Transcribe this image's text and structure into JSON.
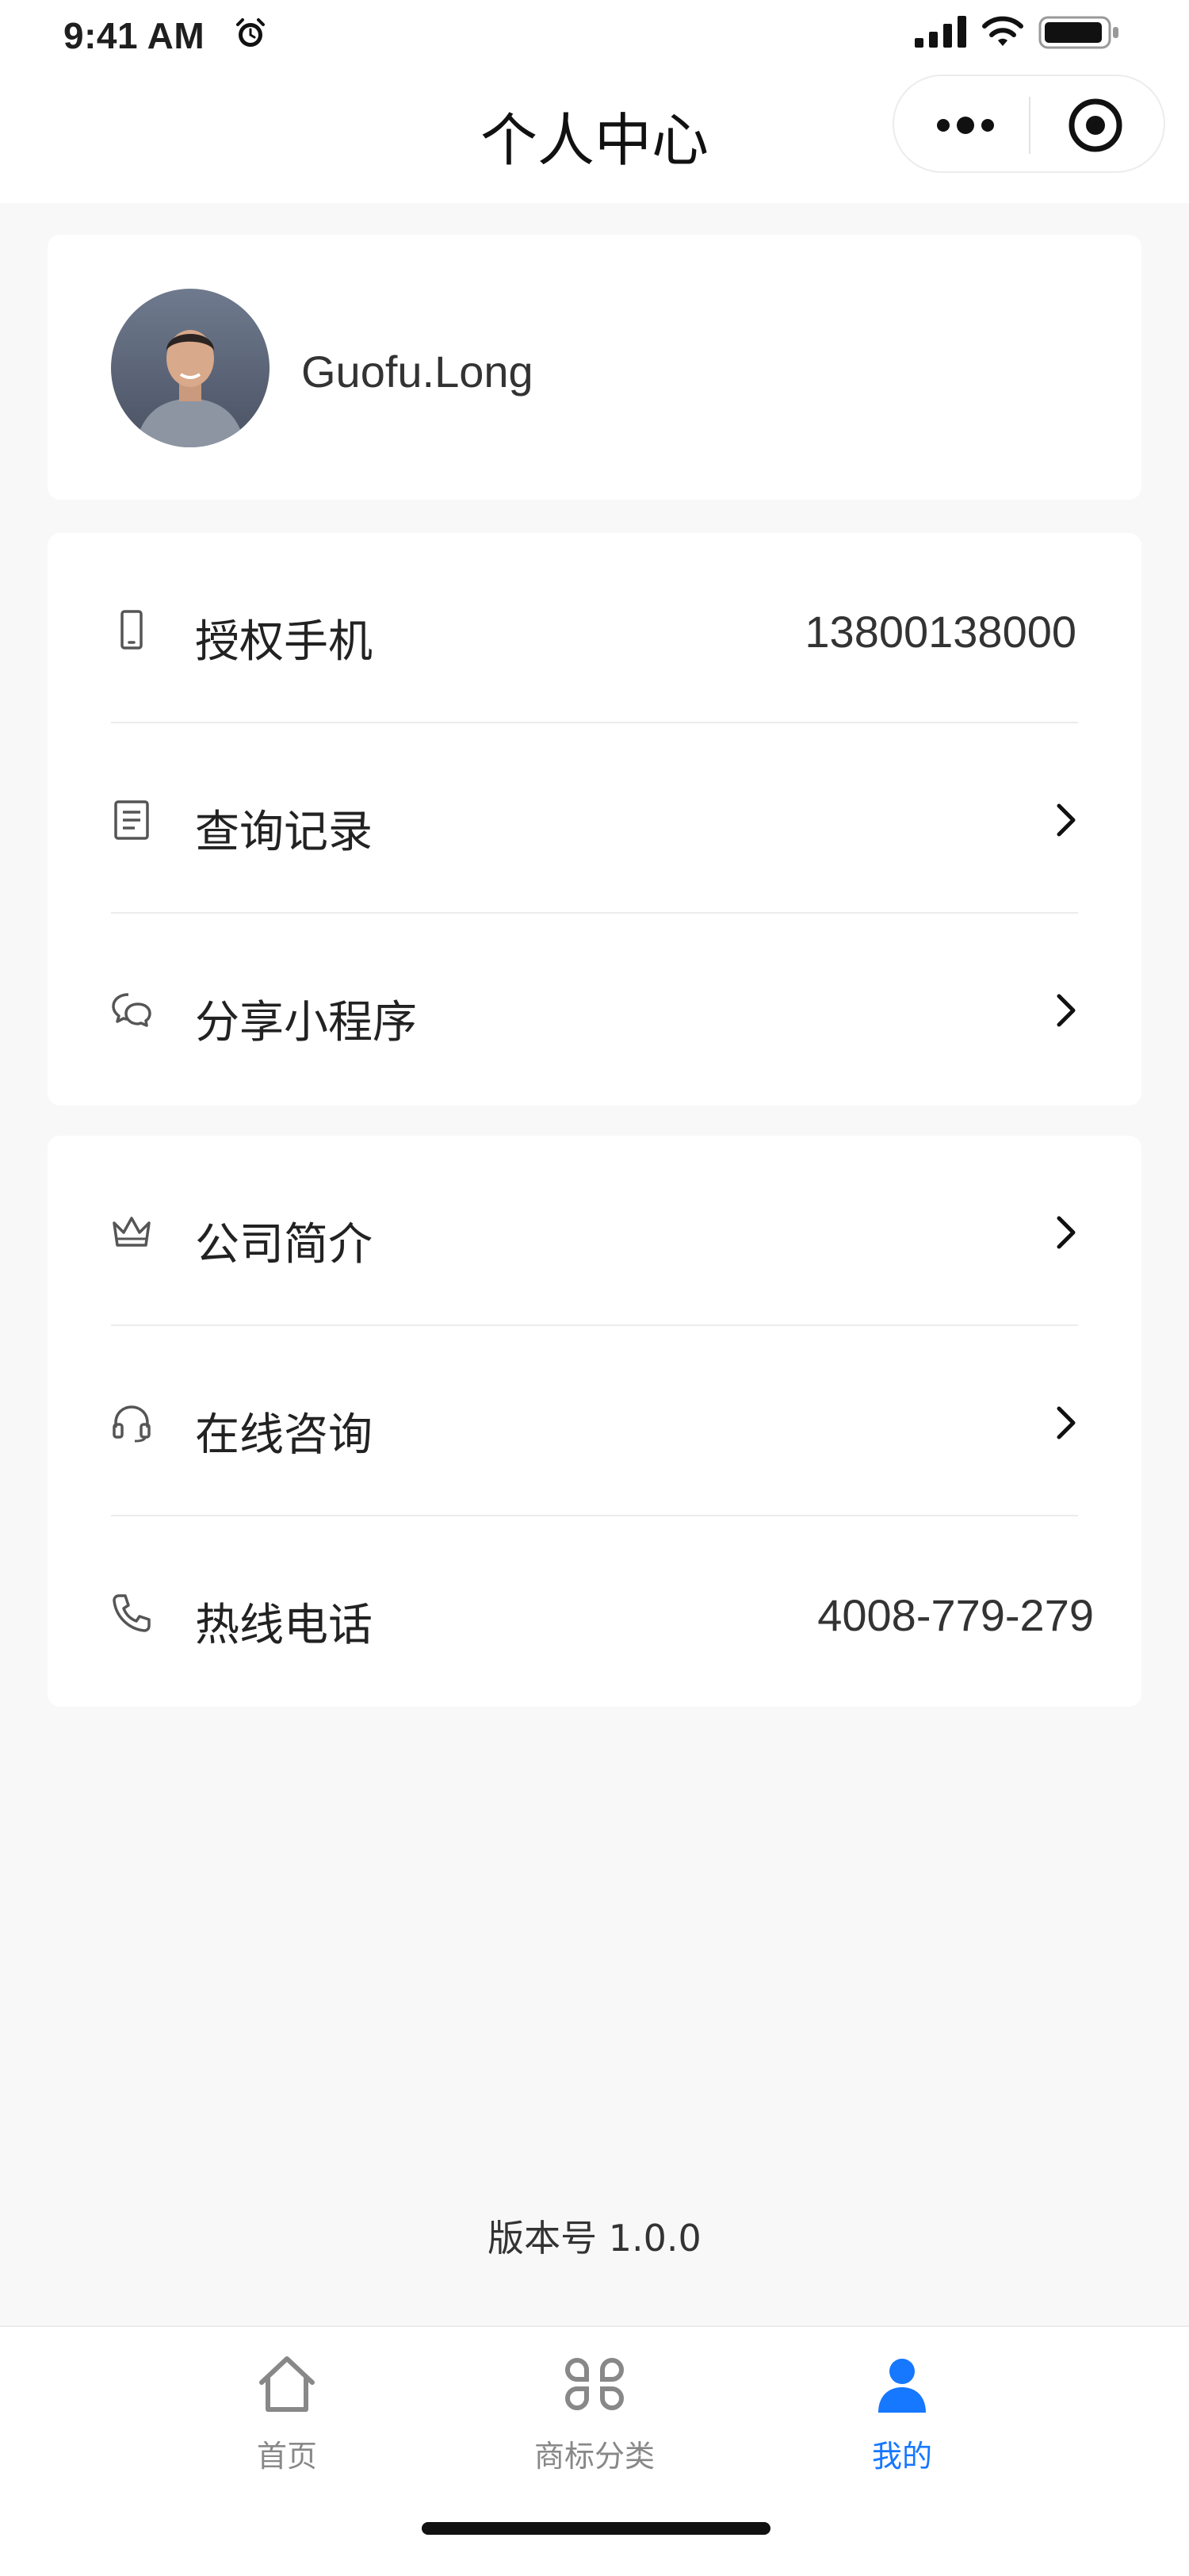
{
  "status_bar": {
    "time": "9:41 AM"
  },
  "header": {
    "title": "个人中心"
  },
  "profile": {
    "username": "Guofu.Long"
  },
  "menu_group_1": [
    {
      "label": "授权手机",
      "value": "13800138000",
      "icon": "phone-device-icon"
    },
    {
      "label": "查询记录",
      "icon": "document-icon"
    },
    {
      "label": "分享小程序",
      "icon": "chat-bubbles-icon"
    }
  ],
  "menu_group_2": [
    {
      "label": "公司简介",
      "icon": "crown-icon"
    },
    {
      "label": "在线咨询",
      "icon": "headset-icon"
    },
    {
      "label": "热线电话",
      "value": "4008-779-279",
      "icon": "telephone-icon"
    }
  ],
  "footer": {
    "version": "版本号 1.0.0"
  },
  "tabbar": {
    "items": [
      {
        "label": "首页",
        "icon": "home-icon"
      },
      {
        "label": "商标分类",
        "icon": "category-icon"
      },
      {
        "label": "我的",
        "icon": "user-icon"
      }
    ],
    "active_index": 2
  },
  "colors": {
    "accent": "#1677ff",
    "background": "#f8f8f8",
    "card": "#ffffff"
  }
}
